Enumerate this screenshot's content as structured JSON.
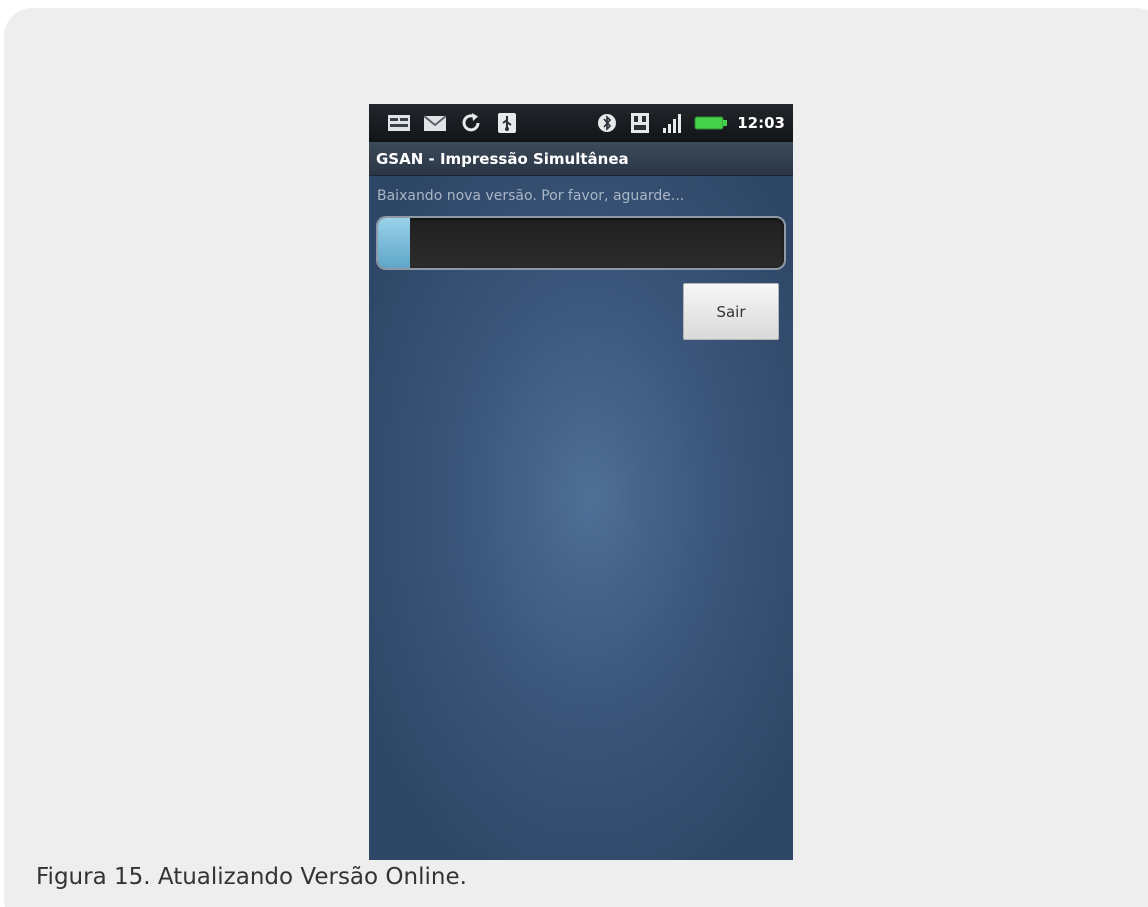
{
  "status_bar": {
    "time": "12:03",
    "left_icons": [
      "notification-icon",
      "email-icon",
      "sync-icon",
      "usb-icon"
    ],
    "right_icons": [
      "bluetooth-icon",
      "sd-card-icon",
      "signal-icon",
      "battery-icon"
    ]
  },
  "app": {
    "title": "GSAN - Impressão Simultânea"
  },
  "download": {
    "message": "Baixando nova versão. Por favor, aguarde...",
    "progress_fraction": 0.08
  },
  "buttons": {
    "exit_label": "Sair"
  },
  "caption": "Figura 15. Atualizando Versão Online.",
  "colors": {
    "progress_fill": "#6fb6d6",
    "screen_background": "#3c587d"
  }
}
